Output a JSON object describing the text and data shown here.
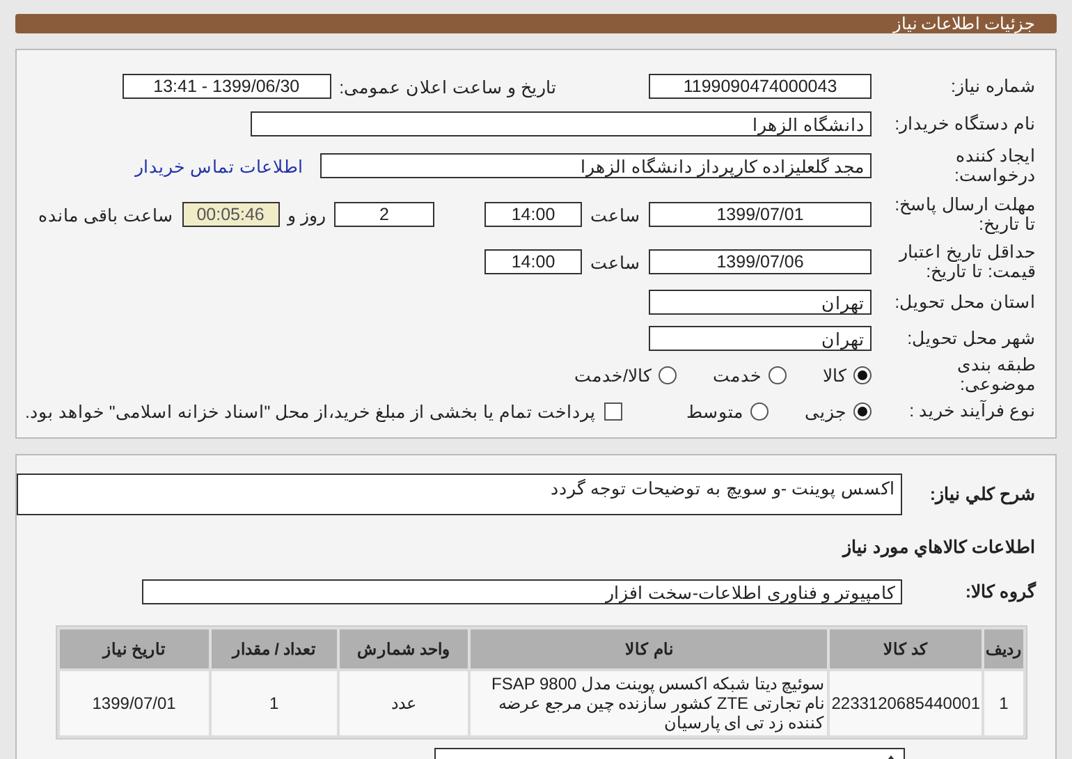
{
  "header": {
    "title": "جزئیات اطلاعات نیاز"
  },
  "need_number": {
    "label": "شماره نیاز:",
    "value": "1199090474000043"
  },
  "announce": {
    "label": "تاریخ و ساعت اعلان عمومی:",
    "value": "1399/06/30 - 13:41"
  },
  "buyer": {
    "label": "نام دستگاه خریدار:",
    "value": "دانشگاه الزهرا"
  },
  "creator": {
    "label": "ایجاد کننده درخواست:",
    "value": "مجد گلعلیزاده کارپرداز دانشگاه الزهرا",
    "link": "اطلاعات تماس خریدار"
  },
  "deadline": {
    "label": "مهلت ارسال پاسخ: تا تاریخ:",
    "date": "1399/07/01",
    "time_label": "ساعت",
    "time": "14:00",
    "days": "2",
    "days_label": "روز و",
    "remaining": "00:05:46",
    "remaining_label": "ساعت باقی مانده"
  },
  "validity": {
    "label": "حداقل تاریخ اعتبار قیمت: تا تاریخ:",
    "date": "1399/07/06",
    "time_label": "ساعت",
    "time": "14:00"
  },
  "province": {
    "label": "استان محل تحویل:",
    "value": "تهران"
  },
  "city": {
    "label": "شهر محل تحویل:",
    "value": "تهران"
  },
  "category": {
    "label": "طبقه بندی موضوعی:",
    "options": [
      {
        "label": "کالا",
        "selected": true
      },
      {
        "label": "خدمت",
        "selected": false
      },
      {
        "label": "کالا/خدمت",
        "selected": false
      }
    ]
  },
  "process": {
    "label": "نوع فرآیند خرید :",
    "options": [
      {
        "label": "جزیی",
        "selected": true
      },
      {
        "label": "متوسط",
        "selected": false
      }
    ],
    "payment": {
      "label": "پرداخت تمام یا بخشی از مبلغ خرید،از محل \"اسناد خزانه اسلامی\" خواهد بود.",
      "checked": false
    }
  },
  "description": {
    "label": "شرح کلي نياز:",
    "value": "اکسس پوینت -و سویچ به توضیحات توجه گردد"
  },
  "goods_title": "اطلاعات کالاهاي مورد نياز",
  "goods_group": {
    "label": "گروه کالا:",
    "value": "کامپیوتر و فناوری اطلاعات-سخت افزار"
  },
  "table": {
    "columns": [
      "ردیف",
      "کد کالا",
      "نام کالا",
      "واحد شمارش",
      "تعداد / مقدار",
      "تاریخ نیاز"
    ],
    "rows": [
      [
        "1",
        "2233120685440001",
        "سوئیچ دیتا شبکه اکسس پوینت مدل FSAP 9800 نام تجارتی ZTE کشور سازنده چین مرجع عرضه کننده زد تی ای پارسیان",
        "عدد",
        "1",
        "1399/07/01"
      ]
    ]
  }
}
